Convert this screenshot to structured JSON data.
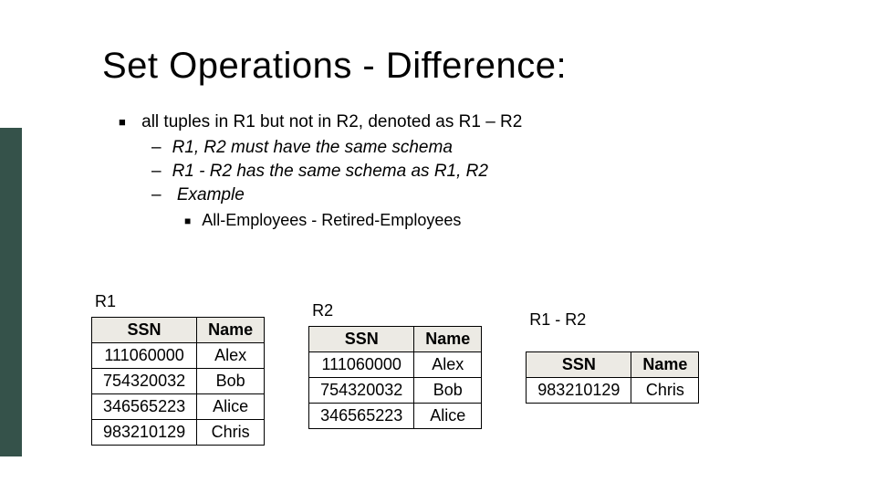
{
  "title": "Set Operations - Difference:",
  "bullets": {
    "line1": "all tuples in R1 but not in R2, denoted as  R1 – R2",
    "sub1": "R1, R2 must have the same schema",
    "sub2": "R1 - R2 has the same schema as R1, R2",
    "sub3": "Example",
    "subsub1": "All-Employees  -  Retired-Employees"
  },
  "tables": {
    "r1": {
      "label": "R1",
      "headers": [
        "SSN",
        "Name"
      ],
      "rows": [
        [
          "111060000",
          "Alex"
        ],
        [
          "754320032",
          "Bob"
        ],
        [
          "346565223",
          "Alice"
        ],
        [
          "983210129",
          "Chris"
        ]
      ]
    },
    "r2": {
      "label": "R2",
      "headers": [
        "SSN",
        "Name"
      ],
      "rows": [
        [
          "111060000",
          "Alex"
        ],
        [
          "754320032",
          "Bob"
        ],
        [
          "346565223",
          "Alice"
        ]
      ]
    },
    "diff": {
      "label": "R1 - R2",
      "headers": [
        "SSN",
        "Name"
      ],
      "rows": [
        [
          "983210129",
          "Chris"
        ]
      ]
    }
  }
}
